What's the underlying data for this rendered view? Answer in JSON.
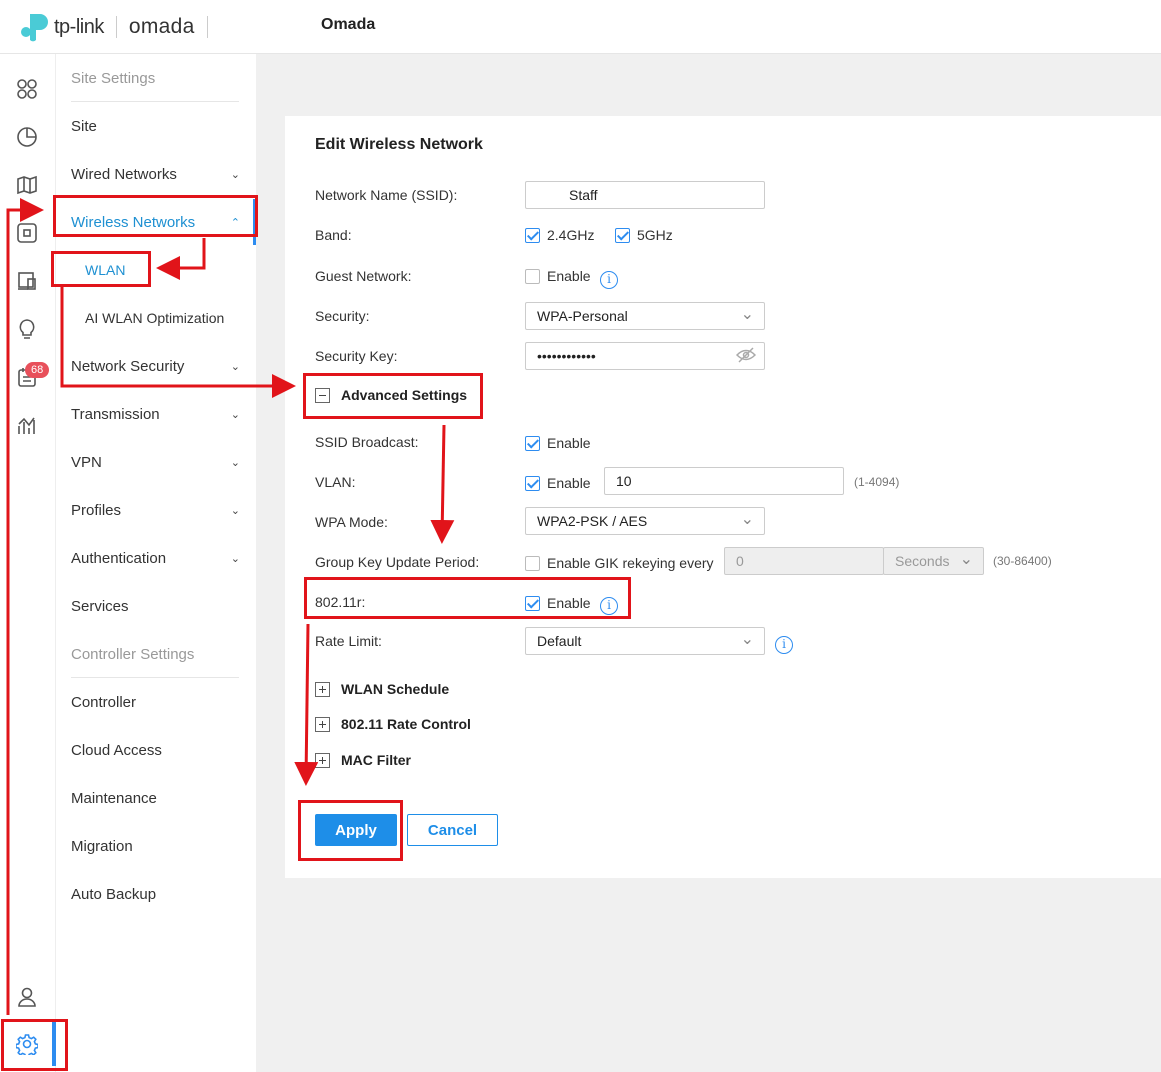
{
  "header": {
    "brand": "tp-link",
    "product": "omada",
    "title": "Omada"
  },
  "iconbar": {
    "items": [
      "dashboard-icon",
      "statistics-icon",
      "map-icon",
      "devices-icon",
      "clients-icon",
      "insight-icon",
      "logs-icon",
      "reports-icon"
    ],
    "logs_badge": "68",
    "bottom": [
      "account-icon",
      "settings-icon"
    ]
  },
  "menu": {
    "site_settings": "Site Settings",
    "site": "Site",
    "wired_networks": "Wired Networks",
    "wireless_networks": "Wireless Networks",
    "wlan": "WLAN",
    "ai_wlan": "AI WLAN Optimization",
    "network_security": "Network Security",
    "transmission": "Transmission",
    "vpn": "VPN",
    "profiles": "Profiles",
    "authentication": "Authentication",
    "services": "Services",
    "controller_settings": "Controller Settings",
    "controller": "Controller",
    "cloud_access": "Cloud Access",
    "maintenance": "Maintenance",
    "migration": "Migration",
    "auto_backup": "Auto Backup"
  },
  "form": {
    "title": "Edit Wireless Network",
    "ssid_label": "Network Name (SSID):",
    "ssid_value": "Staff",
    "band_label": "Band:",
    "band_24": "2.4GHz",
    "band_5": "5GHz",
    "guest_label": "Guest Network:",
    "enable": "Enable",
    "security_label": "Security:",
    "security_value": "WPA-Personal",
    "key_label": "Security Key:",
    "key_value": "••••••••••••",
    "advanced": "Advanced Settings",
    "ssid_broadcast_label": "SSID Broadcast:",
    "vlan_label": "VLAN:",
    "vlan_value": "10",
    "vlan_hint": "(1-4094)",
    "wpa_mode_label": "WPA Mode:",
    "wpa_mode_value": "WPA2-PSK / AES",
    "gik_label": "Group Key Update Period:",
    "gik_enable": "Enable GIK rekeying every",
    "gik_value": "0",
    "gik_unit": "Seconds",
    "gik_hint": "(30-86400)",
    "r_label": "802.11r:",
    "rate_label": "Rate Limit:",
    "rate_value": "Default",
    "wlan_schedule": "WLAN Schedule",
    "rate_control": "802.11 Rate Control",
    "mac_filter": "MAC Filter",
    "apply": "Apply",
    "cancel": "Cancel"
  },
  "colors": {
    "accent": "#1e8ee8",
    "annotation": "#e1141a",
    "badge": "#e8505b"
  }
}
